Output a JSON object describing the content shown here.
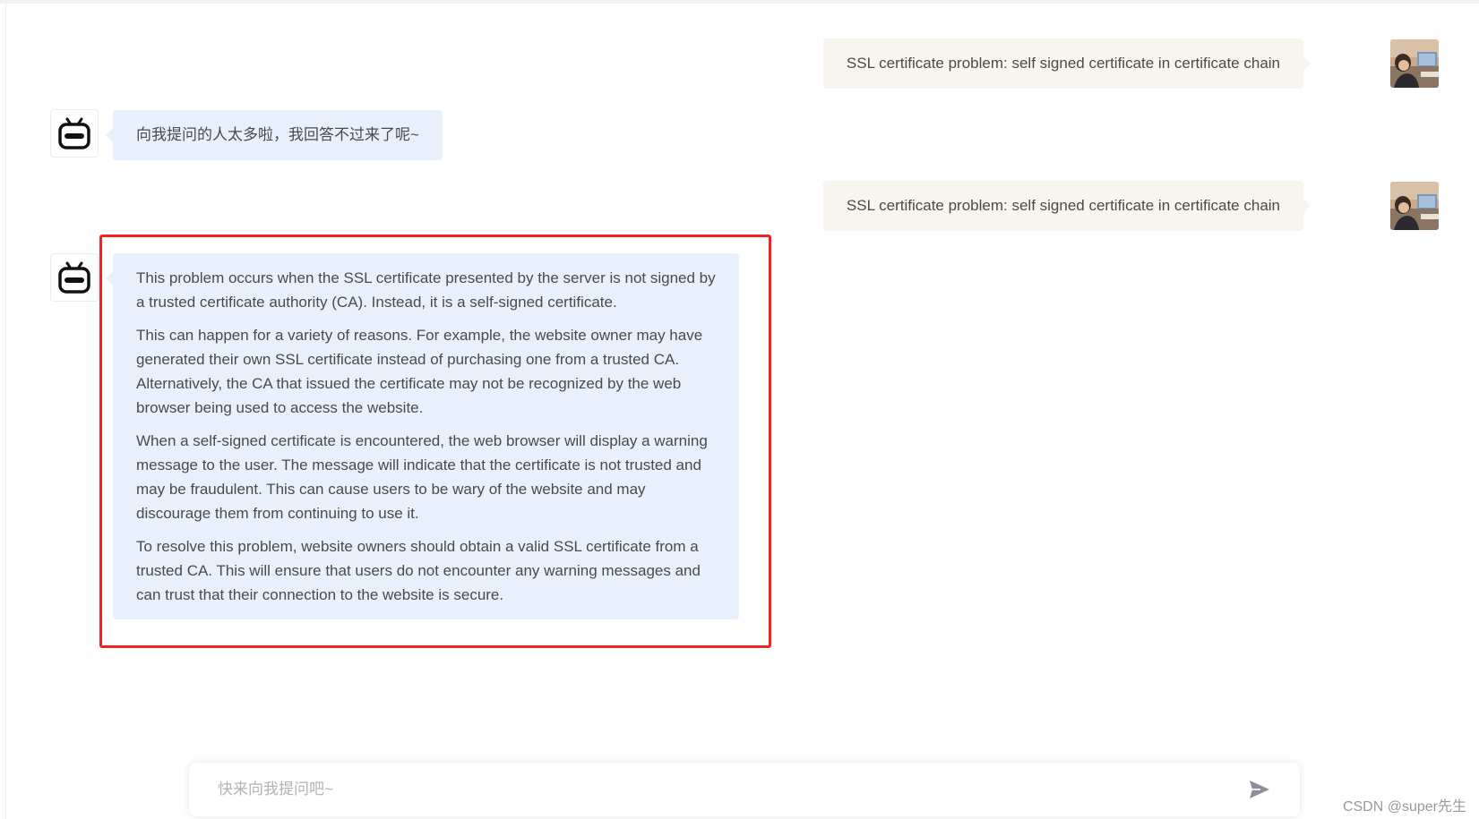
{
  "conversation": {
    "messages": [
      {
        "role": "user",
        "text": "SSL certificate problem: self signed certificate in certificate chain"
      },
      {
        "role": "bot",
        "text": "向我提问的人太多啦，我回答不过来了呢~"
      },
      {
        "role": "user",
        "text": "SSL certificate problem: self signed certificate in certificate chain"
      },
      {
        "role": "bot",
        "paragraphs": [
          "This problem occurs when the SSL certificate presented by the server is not signed by a trusted certificate authority (CA). Instead, it is a self-signed certificate.",
          "This can happen for a variety of reasons. For example, the website owner may have generated their own SSL certificate instead of purchasing one from a trusted CA. Alternatively, the CA that issued the certificate may not be recognized by the web browser being used to access the website.",
          "When a self-signed certificate is encountered, the web browser will display a warning message to the user. The message will indicate that the certificate is not trusted and may be fraudulent. This can cause users to be wary of the website and may discourage them from continuing to use it.",
          "To resolve this problem, website owners should obtain a valid SSL certificate from a trusted CA. This will ensure that users do not encounter any warning messages and can trust that their connection to the website is secure."
        ]
      }
    ]
  },
  "input": {
    "placeholder": "快来向我提问吧~",
    "value": ""
  },
  "icons": {
    "bot_avatar": "robot-icon",
    "user_avatar": "user-photo",
    "send": "send-icon"
  },
  "colors": {
    "user_bubble": "#f8f5ef",
    "bot_bubble": "#e8f1fb",
    "highlight": "#f02323",
    "send_icon": "#8a8f99"
  },
  "watermark": "CSDN @super先生"
}
